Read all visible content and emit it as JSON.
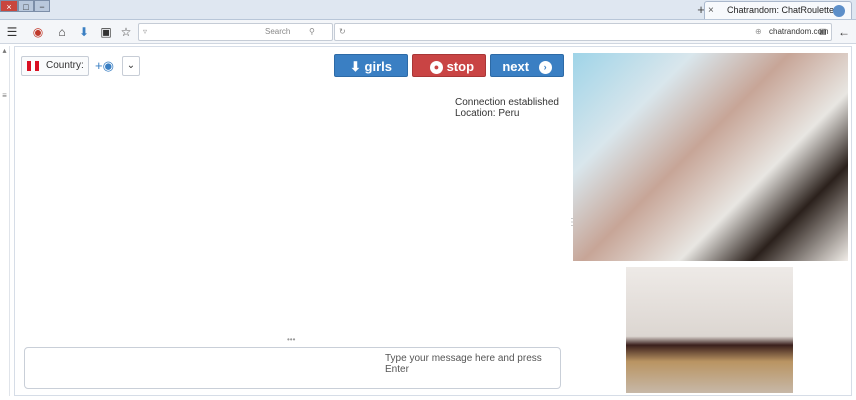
{
  "browser": {
    "tab_title": "Chatrandom: ChatRoulette...",
    "tab_close": "×",
    "new_tab": "+",
    "window_buttons": [
      "×",
      "□",
      "−"
    ],
    "search_placeholder": "Search",
    "url": "chatrandom.com",
    "icons": [
      "menu-icon",
      "addon-icon",
      "home-icon",
      "download-icon",
      "library-icon",
      "star-icon",
      "reload-icon",
      "back-icon"
    ]
  },
  "page": {
    "next_label": "next",
    "stop_label": "stop",
    "girls_label": "girls",
    "country_label": "Country:",
    "connection_status": "Connection established",
    "location": "Location: Peru",
    "message_placeholder": "Type your message here and press Enter",
    "colors": {
      "next": "#3a7fc3",
      "stop": "#c94444",
      "girls": "#3a7fc3"
    }
  }
}
